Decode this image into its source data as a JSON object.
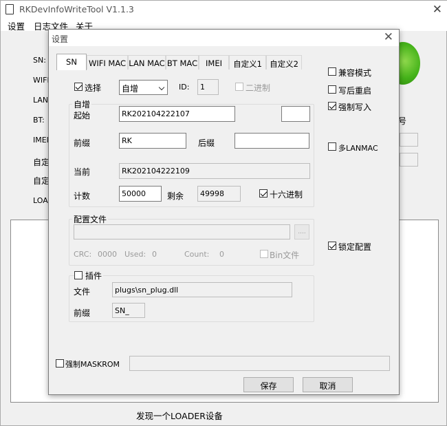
{
  "main_window": {
    "title": "RKDevInfoWriteTool V1.1.3",
    "menu": [
      "设置",
      "日志文件",
      "关于"
    ],
    "behind_labels": {
      "sn": "SN:",
      "wifi": "WIFI",
      "lan": "LAN:",
      "bt": "BT:",
      "imei": "IMEI",
      "custom1": "自定",
      "custom2": "自定",
      "loader": "LOAD",
      "right_char": "号"
    },
    "status": "发现一个LOADER设备"
  },
  "dialog": {
    "title": "设置",
    "tabs": [
      "SN",
      "WIFI MAC",
      "LAN MAC",
      "BT MAC",
      "IMEI",
      "自定义1",
      "自定义2"
    ],
    "active_tab": "SN",
    "sn": {
      "select_label": "选择",
      "select_checked": true,
      "mode_value": "自增",
      "id_label": "ID:",
      "id_value": "1",
      "binary_label": "二进制",
      "auto_group_title": "自增",
      "start_label": "起始",
      "start_value": "RK202104222107",
      "extra_value": "",
      "prefix_label": "前缀",
      "prefix_value": "RK",
      "suffix_label": "后缀",
      "suffix_value": "",
      "current_label": "当前",
      "current_value": "RK202104222109",
      "count_label": "计数",
      "count_value": "50000",
      "remain_label": "剩余",
      "remain_value": "49998",
      "hex_label": "十六进制",
      "hex_checked": true,
      "config_group_title": "配置文件",
      "config_path": "",
      "browse_label": "....",
      "crc_label": "CRC:",
      "crc_value": "0000",
      "used_label": "Used:",
      "used_value": "0",
      "count2_label": "Count:",
      "count2_value": "0",
      "binfile_label": "Bin文件",
      "plugin_label": "插件",
      "plugin_checked": false,
      "file_label": "文件",
      "file_value": "plugs\\sn_plug.dll",
      "plugin_prefix_label": "前缀",
      "plugin_prefix_value": "SN_"
    },
    "options": {
      "compat_mode": "兼容模式",
      "reboot_after_write": "写后重启",
      "force_write": "强制写入",
      "multi_lanmac": "多LANMAC",
      "lock_config": "锁定配置"
    },
    "force_maskrom_label": "强制MASKROM",
    "maskrom_value": "",
    "save_label": "保存",
    "cancel_label": "取消"
  }
}
